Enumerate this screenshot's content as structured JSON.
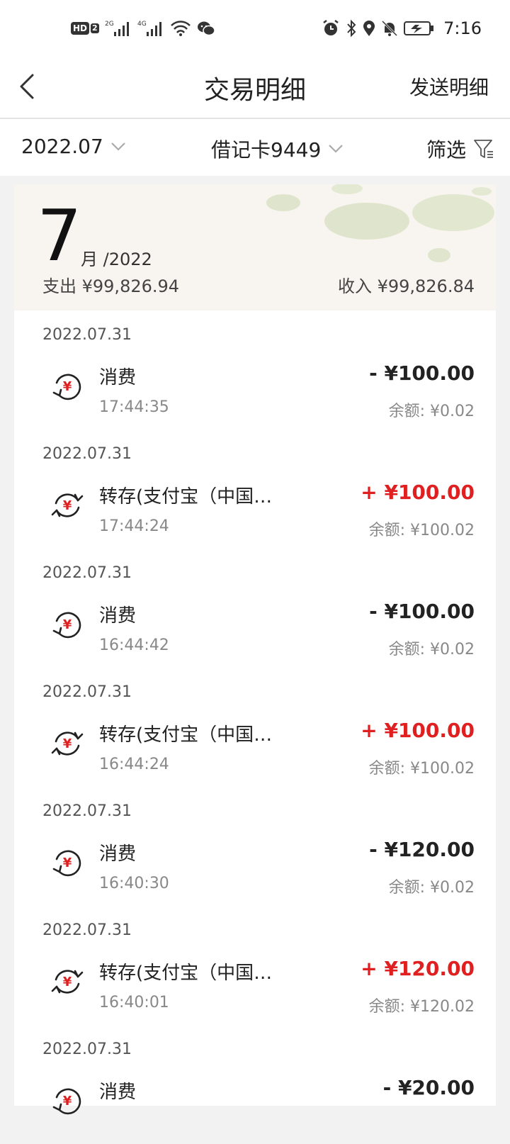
{
  "status_bar": {
    "hd_label": "HD",
    "hd_sub": "2",
    "net1": "2G",
    "net2": "4G",
    "time": "7:16"
  },
  "nav": {
    "title": "交易明细",
    "action": "发送明细"
  },
  "filters": {
    "month": "2022.07",
    "card": "借记卡9449",
    "filter": "筛选"
  },
  "summary": {
    "month_number": "7",
    "month_suffix": "月 /2022",
    "expense": "支出 ¥99,826.94",
    "income": "收入 ¥99,826.84"
  },
  "transactions": [
    {
      "date": "2022.07.31",
      "title": "消费",
      "time": "17:44:35",
      "amount": "- ¥100.00",
      "balance": "余额: ¥0.02",
      "type": "expense"
    },
    {
      "date": "2022.07.31",
      "title": "转存(支付宝（中国…",
      "time": "17:44:24",
      "amount": "+ ¥100.00",
      "balance": "余额: ¥100.02",
      "type": "income"
    },
    {
      "date": "2022.07.31",
      "title": "消费",
      "time": "16:44:42",
      "amount": "- ¥100.00",
      "balance": "余额: ¥0.02",
      "type": "expense"
    },
    {
      "date": "2022.07.31",
      "title": "转存(支付宝（中国…",
      "time": "16:44:24",
      "amount": "+ ¥100.00",
      "balance": "余额: ¥100.02",
      "type": "income"
    },
    {
      "date": "2022.07.31",
      "title": "消费",
      "time": "16:40:30",
      "amount": "- ¥120.00",
      "balance": "余额: ¥0.02",
      "type": "expense"
    },
    {
      "date": "2022.07.31",
      "title": "转存(支付宝（中国…",
      "time": "16:40:01",
      "amount": "+ ¥120.00",
      "balance": "余额: ¥120.02",
      "type": "income"
    },
    {
      "date": "2022.07.31",
      "title": "消费",
      "time": "",
      "amount": "- ¥20.00",
      "balance": "",
      "type": "expense"
    }
  ],
  "colors": {
    "income": "#e02020",
    "expense": "#222222",
    "yuan_icon": "#e02020"
  },
  "icons": {
    "back": "chevron-left-icon",
    "dropdown": "chevron-down-icon",
    "filter": "funnel-icon",
    "expense": "yuan-refresh-icon",
    "income": "yuan-exchange-icon"
  }
}
